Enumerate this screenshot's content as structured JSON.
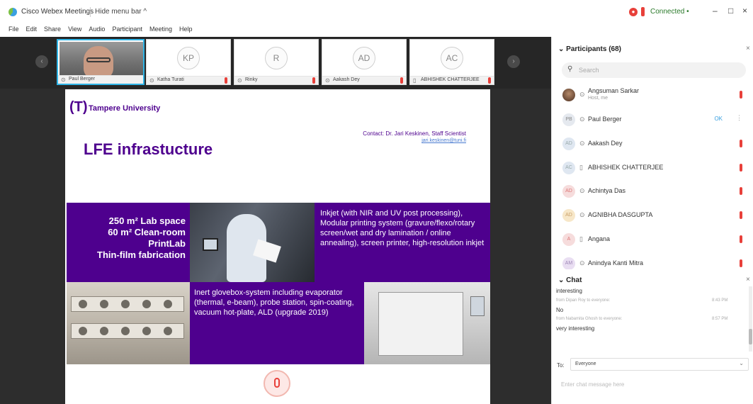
{
  "window": {
    "title": "Cisco Webex Meetings",
    "hide_menu": "Hide menu bar ^",
    "status": "Connected •",
    "controls": {
      "minimize": "–",
      "maximize": "□",
      "close": "×"
    }
  },
  "menu": [
    "File",
    "Edit",
    "Share",
    "View",
    "Audio",
    "Participant",
    "Meeting",
    "Help"
  ],
  "filmstrip": {
    "prev": "‹",
    "next": "›",
    "tiles": [
      {
        "name": "Paul Berger",
        "initials": ""
      },
      {
        "name": "Katha Turati",
        "initials": "KP"
      },
      {
        "name": "Rinky",
        "initials": "R"
      },
      {
        "name": "Aakash Dey",
        "initials": "AD"
      },
      {
        "name": "ABHISHEK CHATTERJEE",
        "initials": "AC"
      }
    ]
  },
  "slide": {
    "logo_mark": "(⁢T)",
    "org": "Tampere University",
    "contact": "Contact: Dr. Jari Keskinen, Staff Scientist",
    "contact_email": "jari.keskinen@tuni.fi",
    "title": "LFE infrastucture",
    "block1": [
      "250 m² Lab space",
      "60 m² Clean-room",
      "PrintLab",
      "Thin-film fabrication"
    ],
    "block2": "Inkjet (with NIR and UV post processing), Modular printing system (gravure/flexo/rotary screen/wet and dry lamination / online annealing), screen printer, high-resolution inkjet",
    "block3": "Inert glovebox-system including evaporator (thermal, e-beam), probe station, spin-coating, vacuum hot-plate, ALD (upgrade 2019)"
  },
  "panel": {
    "participants_title": "Participants (68)",
    "search_placeholder": "Search",
    "participants": [
      {
        "name": "Angsuman Sarkar",
        "role": "Host, me",
        "avatar": "",
        "device": "⊙"
      },
      {
        "name": "Paul Berger",
        "role": "",
        "avatar": "PB",
        "device": "⊙",
        "status": "OK"
      },
      {
        "name": "Aakash Dey",
        "role": "",
        "avatar": "AD",
        "device": "⊙"
      },
      {
        "name": "ABHISHEK CHATTERJEE",
        "role": "",
        "avatar": "AC",
        "device": "▯"
      },
      {
        "name": "Achintya Das",
        "role": "",
        "avatar": "AD",
        "device": "⊙"
      },
      {
        "name": "AGNIBHA DASGUPTA",
        "role": "",
        "avatar": "AD",
        "device": "⊙"
      },
      {
        "name": "Angana",
        "role": "",
        "avatar": "A",
        "device": "▯"
      },
      {
        "name": "Anindya Kanti Mitra",
        "role": "",
        "avatar": "AM",
        "device": "⊙"
      }
    ],
    "chat_title": "Chat",
    "chat": [
      {
        "text": "interesting",
        "meta": "",
        "time": ""
      },
      {
        "text": "",
        "meta": "from Dipan Roy to everyone:",
        "time": "8:43 PM"
      },
      {
        "text": "No",
        "meta": "",
        "time": ""
      },
      {
        "text": "",
        "meta": "from Nabamita Ghosh to everyone:",
        "time": "8:57 PM"
      },
      {
        "text": "very interesting",
        "meta": "",
        "time": ""
      }
    ],
    "to_label": "To:",
    "to_value": "Everyone",
    "input_placeholder": "Enter chat message here"
  }
}
